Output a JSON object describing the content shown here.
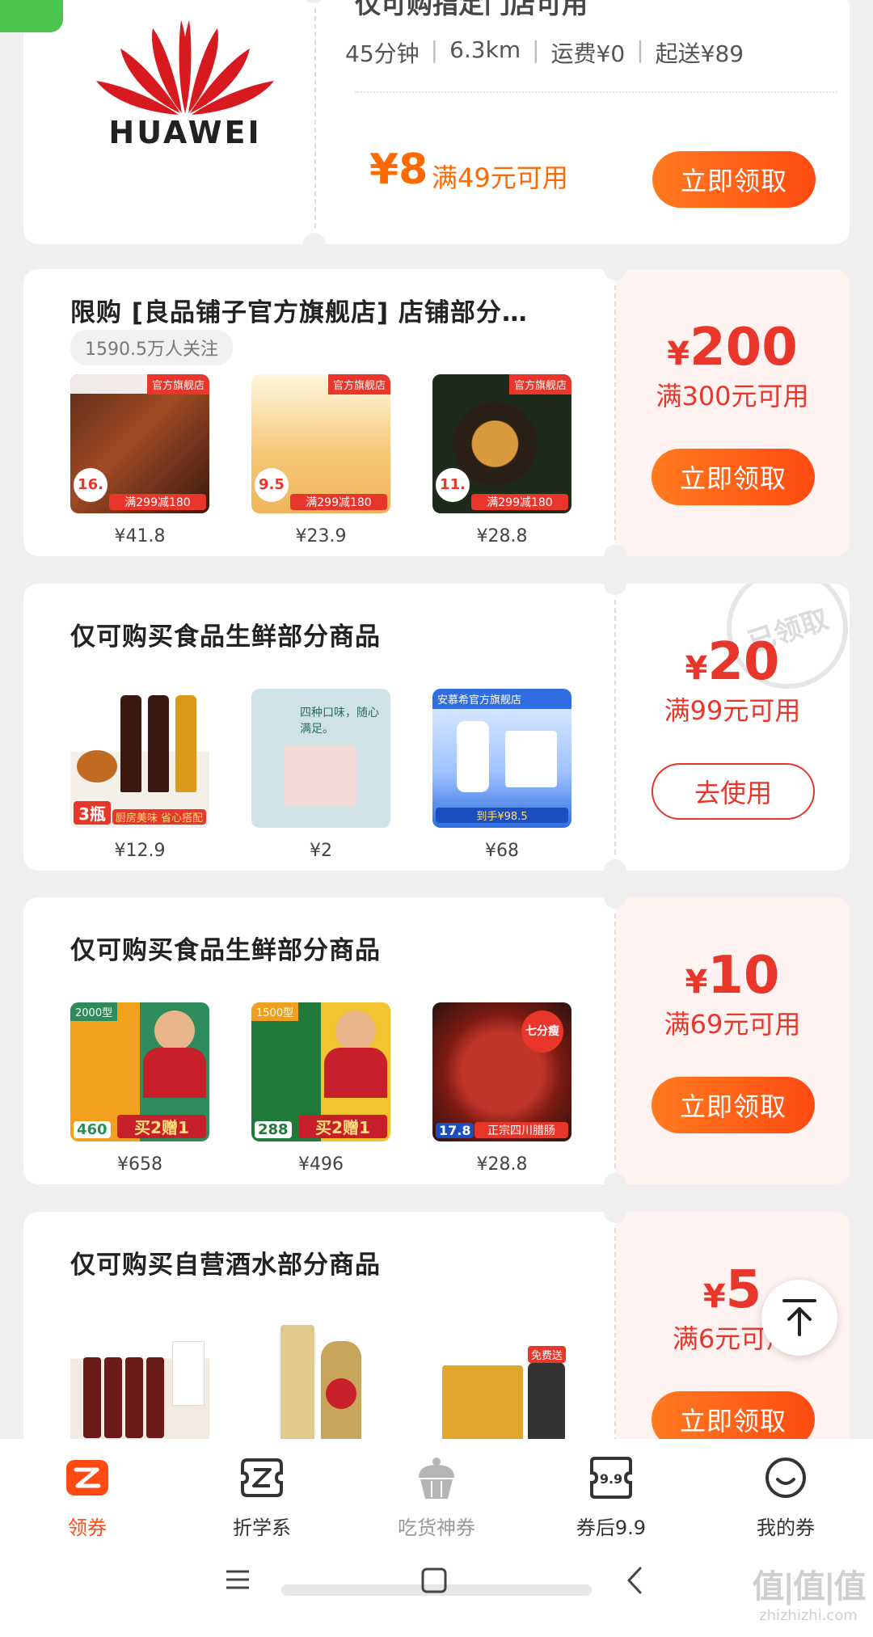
{
  "store_card": {
    "brand": "HUAWEI",
    "title_partial": "仅可购指定门店可用",
    "meta": [
      "45分钟",
      "6.3km",
      "运费¥0",
      "起送¥89"
    ],
    "amount": "¥8",
    "condition": "满49元可用",
    "button": "立即领取"
  },
  "coupons": [
    {
      "title": "限购 [良品铺子官方旗舰店] 店铺部分…",
      "follow": "1590.5万人关注",
      "amount": "200",
      "condition": "满300元可用",
      "button": "立即领取",
      "products": [
        {
          "price": "¥41.8",
          "badge": "16.",
          "promo": "满299减180"
        },
        {
          "price": "¥23.9",
          "badge": "9.5",
          "promo": "满299减180"
        },
        {
          "price": "¥28.8",
          "badge": "11.",
          "promo": "满299减180"
        }
      ]
    },
    {
      "title": "仅可购买食品生鲜部分商品",
      "amount": "20",
      "condition": "满99元可用",
      "button": "去使用",
      "stamp": "已领取",
      "products": [
        {
          "price": "¥12.9",
          "badge": "3瓶",
          "promo": "厨房美味 省心搭配"
        },
        {
          "price": "¥2",
          "caption": "四种口味，随心满足。"
        },
        {
          "price": "¥68",
          "brand": "安慕希官方旗舰店",
          "promo": "到手¥98.5"
        }
      ]
    },
    {
      "title": "仅可购买食品生鲜部分商品",
      "amount": "10",
      "condition": "满69元可用",
      "button": "立即领取",
      "products": [
        {
          "price": "¥658",
          "badge": "2000型",
          "promo": "买2赠1",
          "sub": "460"
        },
        {
          "price": "¥496",
          "badge": "1500型",
          "promo": "买2赠1",
          "sub": "288"
        },
        {
          "price": "¥28.8",
          "badge": "七分瘦",
          "promo": "正宗四川腊肠",
          "sub": "17.8"
        }
      ]
    },
    {
      "title": "仅可购买自营酒水部分商品",
      "amount": "5",
      "condition": "满6元可用",
      "button": "立即领取",
      "products": [
        {
          "price": ""
        },
        {
          "price": ""
        },
        {
          "price": "",
          "promo": "免费送"
        }
      ]
    }
  ],
  "nav": [
    {
      "label": "领券",
      "icon": "coupon-icon",
      "active": true
    },
    {
      "label": "折学系",
      "icon": "z-icon",
      "active": false
    },
    {
      "label": "吃货神券",
      "icon": "cupcake-icon",
      "active": false
    },
    {
      "label": "券后9.9",
      "icon": "ticket-icon",
      "active": false
    },
    {
      "label": "我的券",
      "icon": "smile-icon",
      "active": false
    }
  ],
  "back_to_top": "↑",
  "watermark": "值|值|值",
  "watermark_url": "zhizhizhi.com",
  "colors": {
    "accent": "#e8362b",
    "button": "#ff5a16"
  }
}
